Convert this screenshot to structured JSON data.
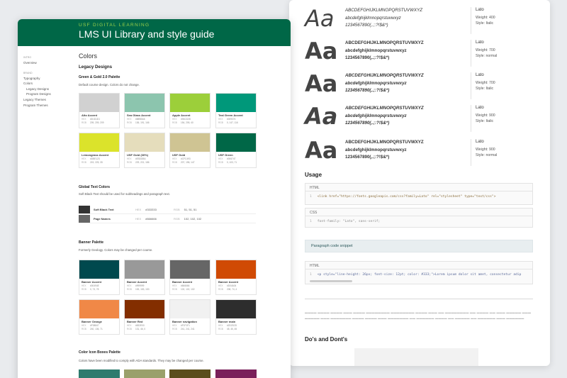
{
  "header": {
    "subtitle": "USF DIGITAL LEARNING",
    "title": "LMS UI Library and style guide"
  },
  "sidebar": {
    "section_intro": "INTRO",
    "overview": "Overview",
    "section_brand": "BRAND",
    "typography": "Typography",
    "colors": "Colors",
    "legacy_designs": "Legacy Designs",
    "program_designs": "Program Designs",
    "legacy_themes": "Legacy Themes",
    "program_themes": "Program Themes"
  },
  "colors_page": {
    "title": "Colors",
    "legacy_title": "Legacy Designs",
    "gg_title": "Green & Gold 2.0 Palette",
    "gg_desc": "Default course design. Colors do not change.",
    "hex_label": "HEX",
    "rgb_label": "RGB",
    "gg_swatches": [
      {
        "name": "Alto Accent",
        "hex": "#D1D1D1",
        "rgb": "209, 209, 209",
        "color": "#d1d1d1"
      },
      {
        "name": "Sea Glass Accent",
        "hex": "#88BBA6",
        "rgb": "136, 191, 166",
        "color": "#8cc5ae"
      },
      {
        "name": "Apple Accent",
        "hex": "#9ACD28",
        "rgb": "154, 205, 40",
        "color": "#9ccf3a"
      },
      {
        "name": "Teal Green Accent",
        "hex": "#009374",
        "rgb": "0, 147, 116",
        "color": "#00987a"
      },
      {
        "name": "Lemongrass Accent",
        "hex": "#DBE123",
        "rgb": "219, 225, 35",
        "color": "#dbe32b"
      },
      {
        "name": "USF Gold (30%)",
        "hex": "#E5DDBA",
        "rgb": "229, 221, 186",
        "color": "#e5ddbc"
      },
      {
        "name": "USF Gold",
        "hex": "#CFC493",
        "rgb": "207, 196, 147",
        "color": "#cfc493"
      },
      {
        "name": "USF Green",
        "hex": "#006747",
        "rgb": "0, 103, 71",
        "color": "#006747"
      }
    ],
    "global_title": "Global Text Colors",
    "global_desc": "Soft Black Text should be used for subheadings and paragraph text.",
    "global_rows": [
      {
        "name": "Soft Black Text",
        "hex": "#333333",
        "rgb": "51, 51, 51",
        "color": "#333333"
      },
      {
        "name": "Page Names",
        "hex": "#666666",
        "rgb": "102, 102, 102",
        "color": "#666666"
      }
    ],
    "banner_title": "Banner Palette",
    "banner_desc": "Formerly Geology. Colors may be changed per course.",
    "banner_swatches": [
      {
        "name": "Banner Accent",
        "hex": "#00494E",
        "rgb": "0, 73, 78",
        "color": "#00494e"
      },
      {
        "name": "Banner Accent",
        "hex": "#999999",
        "rgb": "153, 153, 153",
        "color": "#999999"
      },
      {
        "name": "Banner Accent",
        "hex": "#666666",
        "rgb": "102, 102, 102",
        "color": "#666666"
      },
      {
        "name": "Banner Accent",
        "hex": "#D04A04",
        "rgb": "208, 74, 4",
        "color": "#d04a04"
      },
      {
        "name": "Banner Orange",
        "hex": "#F08847",
        "rgb": "240, 136, 71",
        "color": "#f08847"
      },
      {
        "name": "Banner Red",
        "hex": "#832E00",
        "rgb": "131, 46, 0",
        "color": "#832e00"
      },
      {
        "name": "Banner navigation",
        "hex": "#F1F1F1",
        "rgb": "241, 241, 241",
        "color": "#f1f1f1"
      },
      {
        "name": "Banner main",
        "hex": "#2D2D2D",
        "rgb": "45, 45, 45",
        "color": "#2d2d2d"
      }
    ],
    "cib_title": "Color Icon Boxes Palette",
    "cib_desc": "Colors have been modified to comply with ADA standards. They may be changed per course.",
    "cib_colors": [
      "#2e7b6e",
      "#9aa06b",
      "#5a4d1c",
      "#7a1f5a"
    ]
  },
  "typography": {
    "glyph": "Aa",
    "upper": "ABCDEFGHIJKLMNOPQRSTUVWXYZ",
    "lower": "abcdefghijklmnopqrstuvwxyz",
    "digits": "1234567890(,.;:?!$&*)",
    "weight_label": "Weight:",
    "style_label": "Style:",
    "rows": [
      {
        "font": "Lato",
        "weight": "400",
        "style": "Italic"
      },
      {
        "font": "Lato",
        "weight": "700",
        "style": "normal"
      },
      {
        "font": "Lato",
        "weight": "700",
        "style": "Italic"
      },
      {
        "font": "Lato",
        "weight": "900",
        "style": "Italic"
      },
      {
        "font": "Lato",
        "weight": "900",
        "style": "normal"
      }
    ]
  },
  "usage": {
    "title": "Usage",
    "html_label": "HTML",
    "css_label": "CSS",
    "html_code": "<link href=\"https://fonts.googleapis.com/css?family=Lato\" rel=\"stylesheet\" type=\"text/css\">",
    "css_code": "font-family: \"Lato\", sans-serif;",
    "snippet_label": "Paragraph code snippet",
    "para_code": "<p style=\"line-height: 26px; font-size: 12pt; color: #333;\">Lorem ipsum dolor sit amet, consectetur adip",
    "line_no": "1"
  },
  "dos": {
    "title": "Do's and Dont's"
  }
}
